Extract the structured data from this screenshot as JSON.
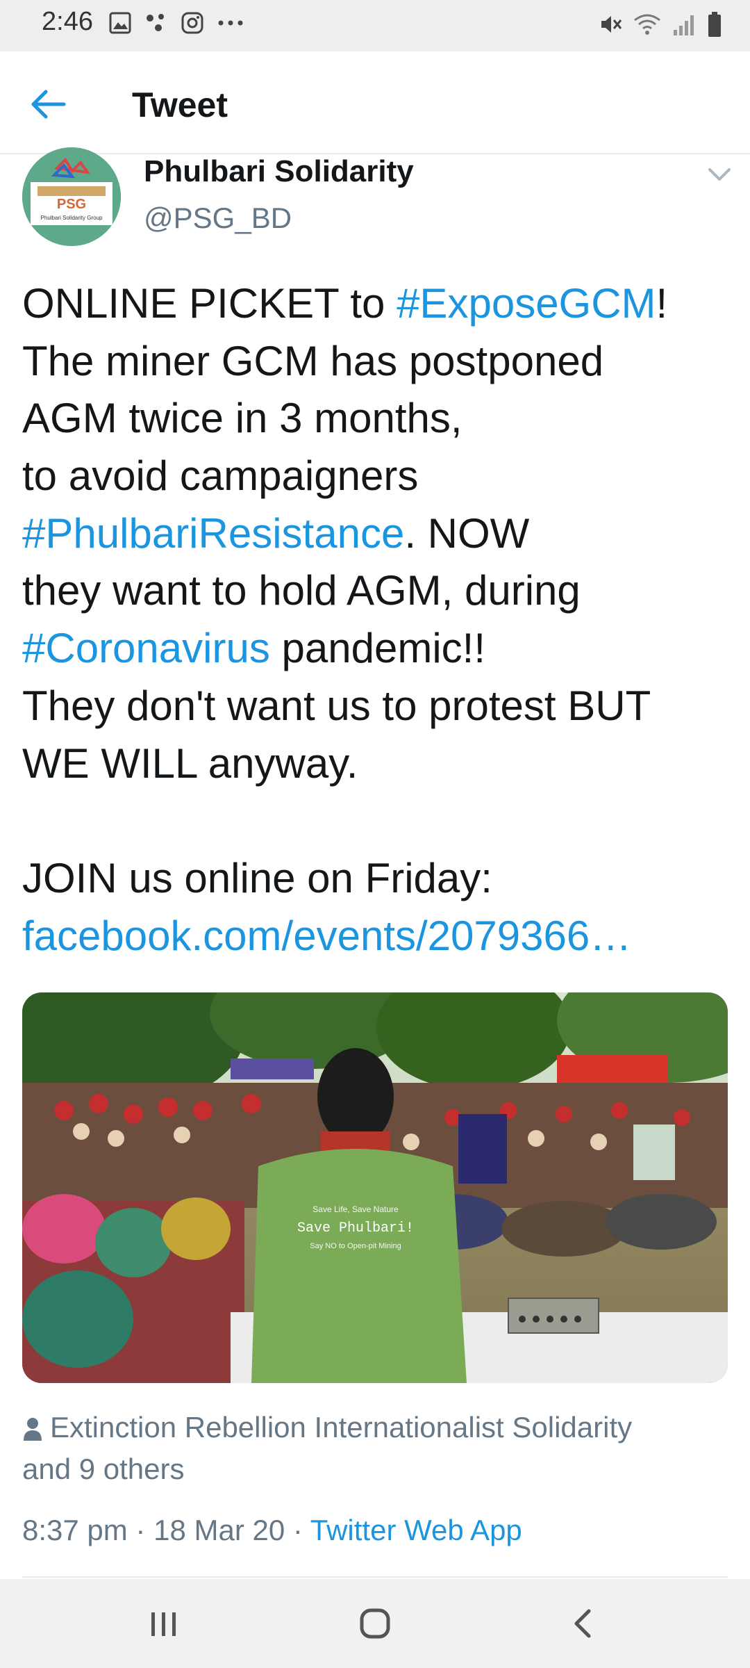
{
  "status_bar": {
    "time": "2:46",
    "left_icons": [
      "gallery-icon",
      "connect-dots-icon",
      "instagram-icon",
      "more-dots-icon"
    ],
    "right_icons": [
      "mute-icon",
      "wifi-icon",
      "signal-icon",
      "battery-icon"
    ]
  },
  "header": {
    "title": "Tweet",
    "back_icon": "arrow-left-icon"
  },
  "author": {
    "display_name": "Phulbari Solidarity",
    "handle": "@PSG_BD",
    "avatar_text": "PSG",
    "avatar_subtext": "Phulbari Solidarity Group"
  },
  "tweet": {
    "line1_text": "ONLINE PICKET to ",
    "line1_link": "#ExposeGCM",
    "line1_end": "!",
    "line2": "The miner GCM has postponed",
    "line3": "AGM twice in 3 months,",
    "line4": "to avoid campaigners",
    "line5_link": "#PhulbariResistance",
    "line5_end": ". NOW",
    "line6": "they want to hold AGM, during",
    "line7_link": "#Coronavirus",
    "line7_end": " pandemic!!",
    "line8": "They don't want us to protest BUT",
    "line9": "WE WILL anyway.",
    "line11": "JOIN us online on Friday:",
    "line12_link": "facebook.com/events/2079366…"
  },
  "media": {
    "shirt_line1": "Save Life, Save Nature",
    "shirt_line2": "Save Phulbari!",
    "shirt_line3": "Say NO to Open-pit Mining"
  },
  "social_context": {
    "line1": "Extinction Rebellion Internationalist Solidarity",
    "line2": "and 9 others"
  },
  "meta": {
    "time_date": "8:37 pm · 18 Mar 20 · ",
    "source": "Twitter Web App"
  },
  "colors": {
    "link": "#1b95e0",
    "text": "#14171a",
    "secondary": "#657786"
  },
  "nav_bar": {
    "icons": [
      "recent-apps-icon",
      "home-icon",
      "back-icon"
    ]
  }
}
